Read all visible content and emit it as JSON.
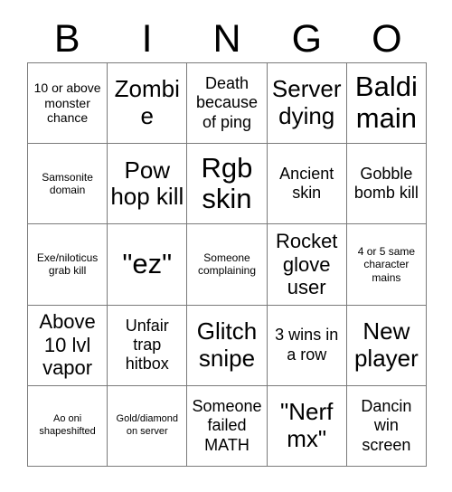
{
  "card": {
    "header_letters": [
      "B",
      "I",
      "N",
      "G",
      "O"
    ],
    "rows": [
      [
        {
          "text": "10 or above monster chance",
          "size": "fs-sm"
        },
        {
          "text": "Zombie",
          "size": "fs-xl"
        },
        {
          "text": "Death because of ping",
          "size": "fs-md"
        },
        {
          "text": "Server dying",
          "size": "fs-xl"
        },
        {
          "text": "Baldi main",
          "size": "fs-xxl"
        }
      ],
      [
        {
          "text": "Samsonite domain",
          "size": "fs-xs"
        },
        {
          "text": "Pow hop kill",
          "size": "fs-xl"
        },
        {
          "text": "Rgb skin",
          "size": "fs-xxl"
        },
        {
          "text": "Ancient skin",
          "size": "fs-md"
        },
        {
          "text": "Gobble bomb kill",
          "size": "fs-md"
        }
      ],
      [
        {
          "text": "Exe/niloticus grab kill",
          "size": "fs-xs"
        },
        {
          "text": "\"ez\"",
          "size": "fs-xxl"
        },
        {
          "text": "Someone complaining",
          "size": "fs-xs"
        },
        {
          "text": "Rocket glove user",
          "size": "fs-lg"
        },
        {
          "text": "4 or 5 same character mains",
          "size": "fs-xs"
        }
      ],
      [
        {
          "text": "Above 10 lvl vapor",
          "size": "fs-lg"
        },
        {
          "text": "Unfair trap hitbox",
          "size": "fs-md"
        },
        {
          "text": "Glitch snipe",
          "size": "fs-xl"
        },
        {
          "text": "3 wins in a row",
          "size": "fs-md"
        },
        {
          "text": "New player",
          "size": "fs-xl"
        }
      ],
      [
        {
          "text": "Ao oni shapeshifted",
          "size": "fs-xxs"
        },
        {
          "text": "Gold/diamond on server",
          "size": "fs-xxs"
        },
        {
          "text": "Someone failed MATH",
          "size": "fs-md"
        },
        {
          "text": "\"Nerf mx\"",
          "size": "fs-xl"
        },
        {
          "text": "Dancin win screen",
          "size": "fs-md"
        }
      ]
    ]
  },
  "colors": {
    "grid_line": "#7a7a7a",
    "text": "#000000",
    "background": "#ffffff"
  }
}
